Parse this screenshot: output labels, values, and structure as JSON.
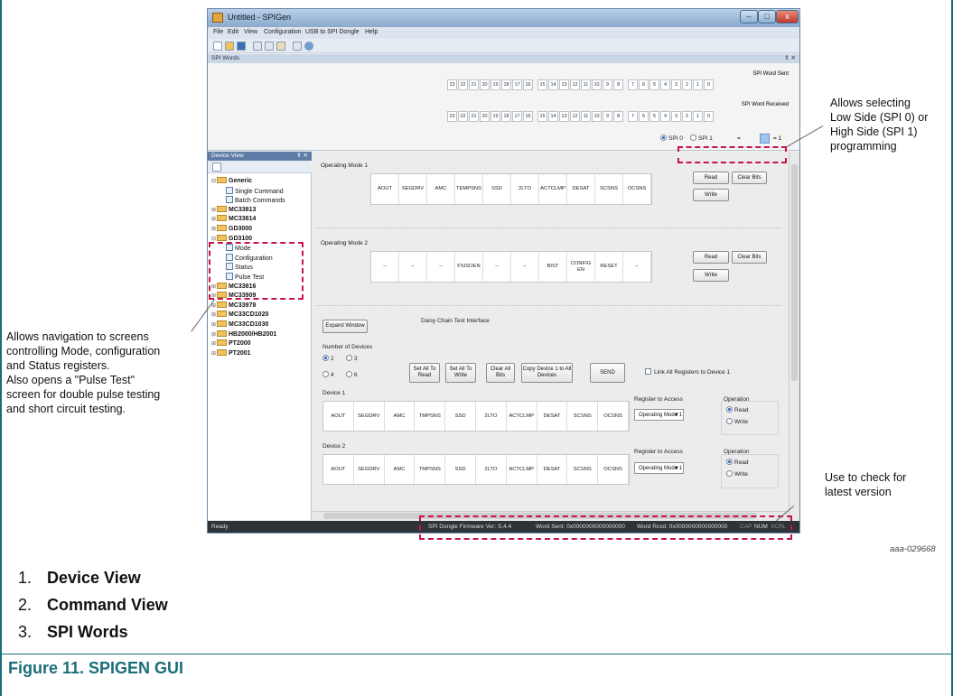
{
  "window": {
    "title": "Untitled - SPIGen",
    "min_glyph": "–",
    "max_glyph": "□",
    "close_glyph": "x",
    "menu": [
      "File",
      "Edit",
      "View",
      "Configuration",
      "USB to SPI Dongle",
      "Help"
    ]
  },
  "spi_words": {
    "pane_title": "SPI Words",
    "pane_pin": "⇕ ✕",
    "sent_label": "SPI Word Sent",
    "received_label": "SPI Word Received",
    "bits": [
      "23",
      "22",
      "21",
      "20",
      "19",
      "18",
      "17",
      "16",
      "15",
      "14",
      "13",
      "12",
      "11",
      "10",
      "9",
      "8",
      "7",
      "6",
      "5",
      "4",
      "3",
      "2",
      "1",
      "0"
    ],
    "spi0_label": "SPI 0",
    "spi1_label": "SPI 1",
    "eq_left": "=",
    "eq_right": "= 1"
  },
  "device_view": {
    "title": "Device View",
    "pin": "⇕ ✕",
    "tree": [
      {
        "label": "Generic",
        "kind": "folder",
        "level": 0,
        "exp": "⊟"
      },
      {
        "label": "Single Command",
        "kind": "leaf",
        "level": 1
      },
      {
        "label": "Batch Commands",
        "kind": "leaf",
        "level": 1
      },
      {
        "label": "MC33813",
        "kind": "folder",
        "level": 0,
        "exp": "⊞"
      },
      {
        "label": "MC33814",
        "kind": "folder",
        "level": 0,
        "exp": "⊞"
      },
      {
        "label": "GD3000",
        "kind": "folder",
        "level": 0,
        "exp": "⊞"
      },
      {
        "label": "GD3100",
        "kind": "folder",
        "level": 0,
        "exp": "⊟"
      },
      {
        "label": "Mode",
        "kind": "leaf",
        "level": 1
      },
      {
        "label": "Configuration",
        "kind": "leaf",
        "level": 1
      },
      {
        "label": "Status",
        "kind": "leaf",
        "level": 1
      },
      {
        "label": "Pulse Test",
        "kind": "leaf",
        "level": 1
      },
      {
        "label": "MC33816",
        "kind": "folder",
        "level": 0,
        "exp": "⊞"
      },
      {
        "label": "MC33909",
        "kind": "folder",
        "level": 0,
        "exp": "⊞"
      },
      {
        "label": "MC33978",
        "kind": "folder",
        "level": 0,
        "exp": "⊞"
      },
      {
        "label": "MC33CD1020",
        "kind": "folder",
        "level": 0,
        "exp": "⊞"
      },
      {
        "label": "MC33CD1030",
        "kind": "folder",
        "level": 0,
        "exp": "⊞"
      },
      {
        "label": "HB2000/HB2001",
        "kind": "folder",
        "level": 0,
        "exp": "⊞"
      },
      {
        "label": "PT2000",
        "kind": "folder",
        "level": 0,
        "exp": "⊞"
      },
      {
        "label": "PT2001",
        "kind": "folder",
        "level": 0,
        "exp": "⊞"
      }
    ]
  },
  "command_view": {
    "mode1": {
      "label": "Operating Mode 1",
      "cols": [
        "AOUT",
        "SEGDRV",
        "AMC",
        "TEMPSNS",
        "SSD",
        "2LTO",
        "ACTCLMP",
        "DESAT",
        "SCSNS",
        "OCSNS"
      ],
      "read": "Read",
      "clear": "Clear Bits",
      "write": "Write"
    },
    "mode2": {
      "label": "Operating Mode 2",
      "cols": [
        "–",
        "–",
        "–",
        "FSISOEN",
        "–",
        "–",
        "BIST",
        "CONFIG EN",
        "RESET",
        "–"
      ],
      "read": "Read",
      "clear": "Clear Bits",
      "write": "Write"
    },
    "daisy": {
      "expand": "Expand Window",
      "title": "Daisy Chain Test Interface",
      "num_devices": "Number of Devices",
      "opts": [
        "2",
        "3",
        "4",
        "6"
      ],
      "set_read": "Set All To Read",
      "set_write": "Set All To Write",
      "clear_all": "Clear All Bits",
      "copy": "Copy Device 1 to All Devices",
      "send": "SEND",
      "link": "Link All Registers to Device 1",
      "devices": [
        {
          "label": "Device 1",
          "register_label": "Register to Access",
          "register": "Operating Mode 1",
          "operation_label": "Operation",
          "op_read": "Read",
          "op_write": "Write"
        },
        {
          "label": "Device 2",
          "register_label": "Register to Access",
          "register": "Operating Mode 1",
          "operation_label": "Operation",
          "op_read": "Read",
          "op_write": "Write"
        }
      ],
      "cols": [
        "AOUT",
        "SEGDRV",
        "AMC",
        "TMPSNS",
        "SSD",
        "2LTO",
        "ACTCLMP",
        "DESAT",
        "SCSNS",
        "OCSNS"
      ]
    }
  },
  "status_bar": {
    "ready": "Ready",
    "firmware": "SPI Dongle Firmware Ver: S.4.4",
    "sent": "Word Sent: 0x0000000000000000",
    "rcvd": "Word Rcvd: 0x0000000000000000",
    "cap": "CAP",
    "num": "NUM",
    "scrl": "SCRL"
  },
  "callouts": {
    "spi": [
      "Allows selecting",
      "Low Side (SPI 0) or",
      "High Side (SPI 1)",
      "programming"
    ],
    "nav": [
      "Allows navigation to screens",
      "controlling Mode, configuration",
      "and Status registers.",
      "Also opens a \"Pulse Test\"",
      "screen for double pulse testing",
      "and short circuit testing."
    ],
    "version": [
      "Use to check for",
      "latest version"
    ]
  },
  "figure_id": "aaa-029668",
  "list": [
    {
      "num": "1.",
      "text": "Device View"
    },
    {
      "num": "2.",
      "text": "Command View"
    },
    {
      "num": "3.",
      "text": "SPI Words"
    }
  ],
  "caption": "Figure 11.  SPIGEN GUI",
  "colors": {
    "accent": "#1b6d7a",
    "highlight": "#c8124b"
  }
}
